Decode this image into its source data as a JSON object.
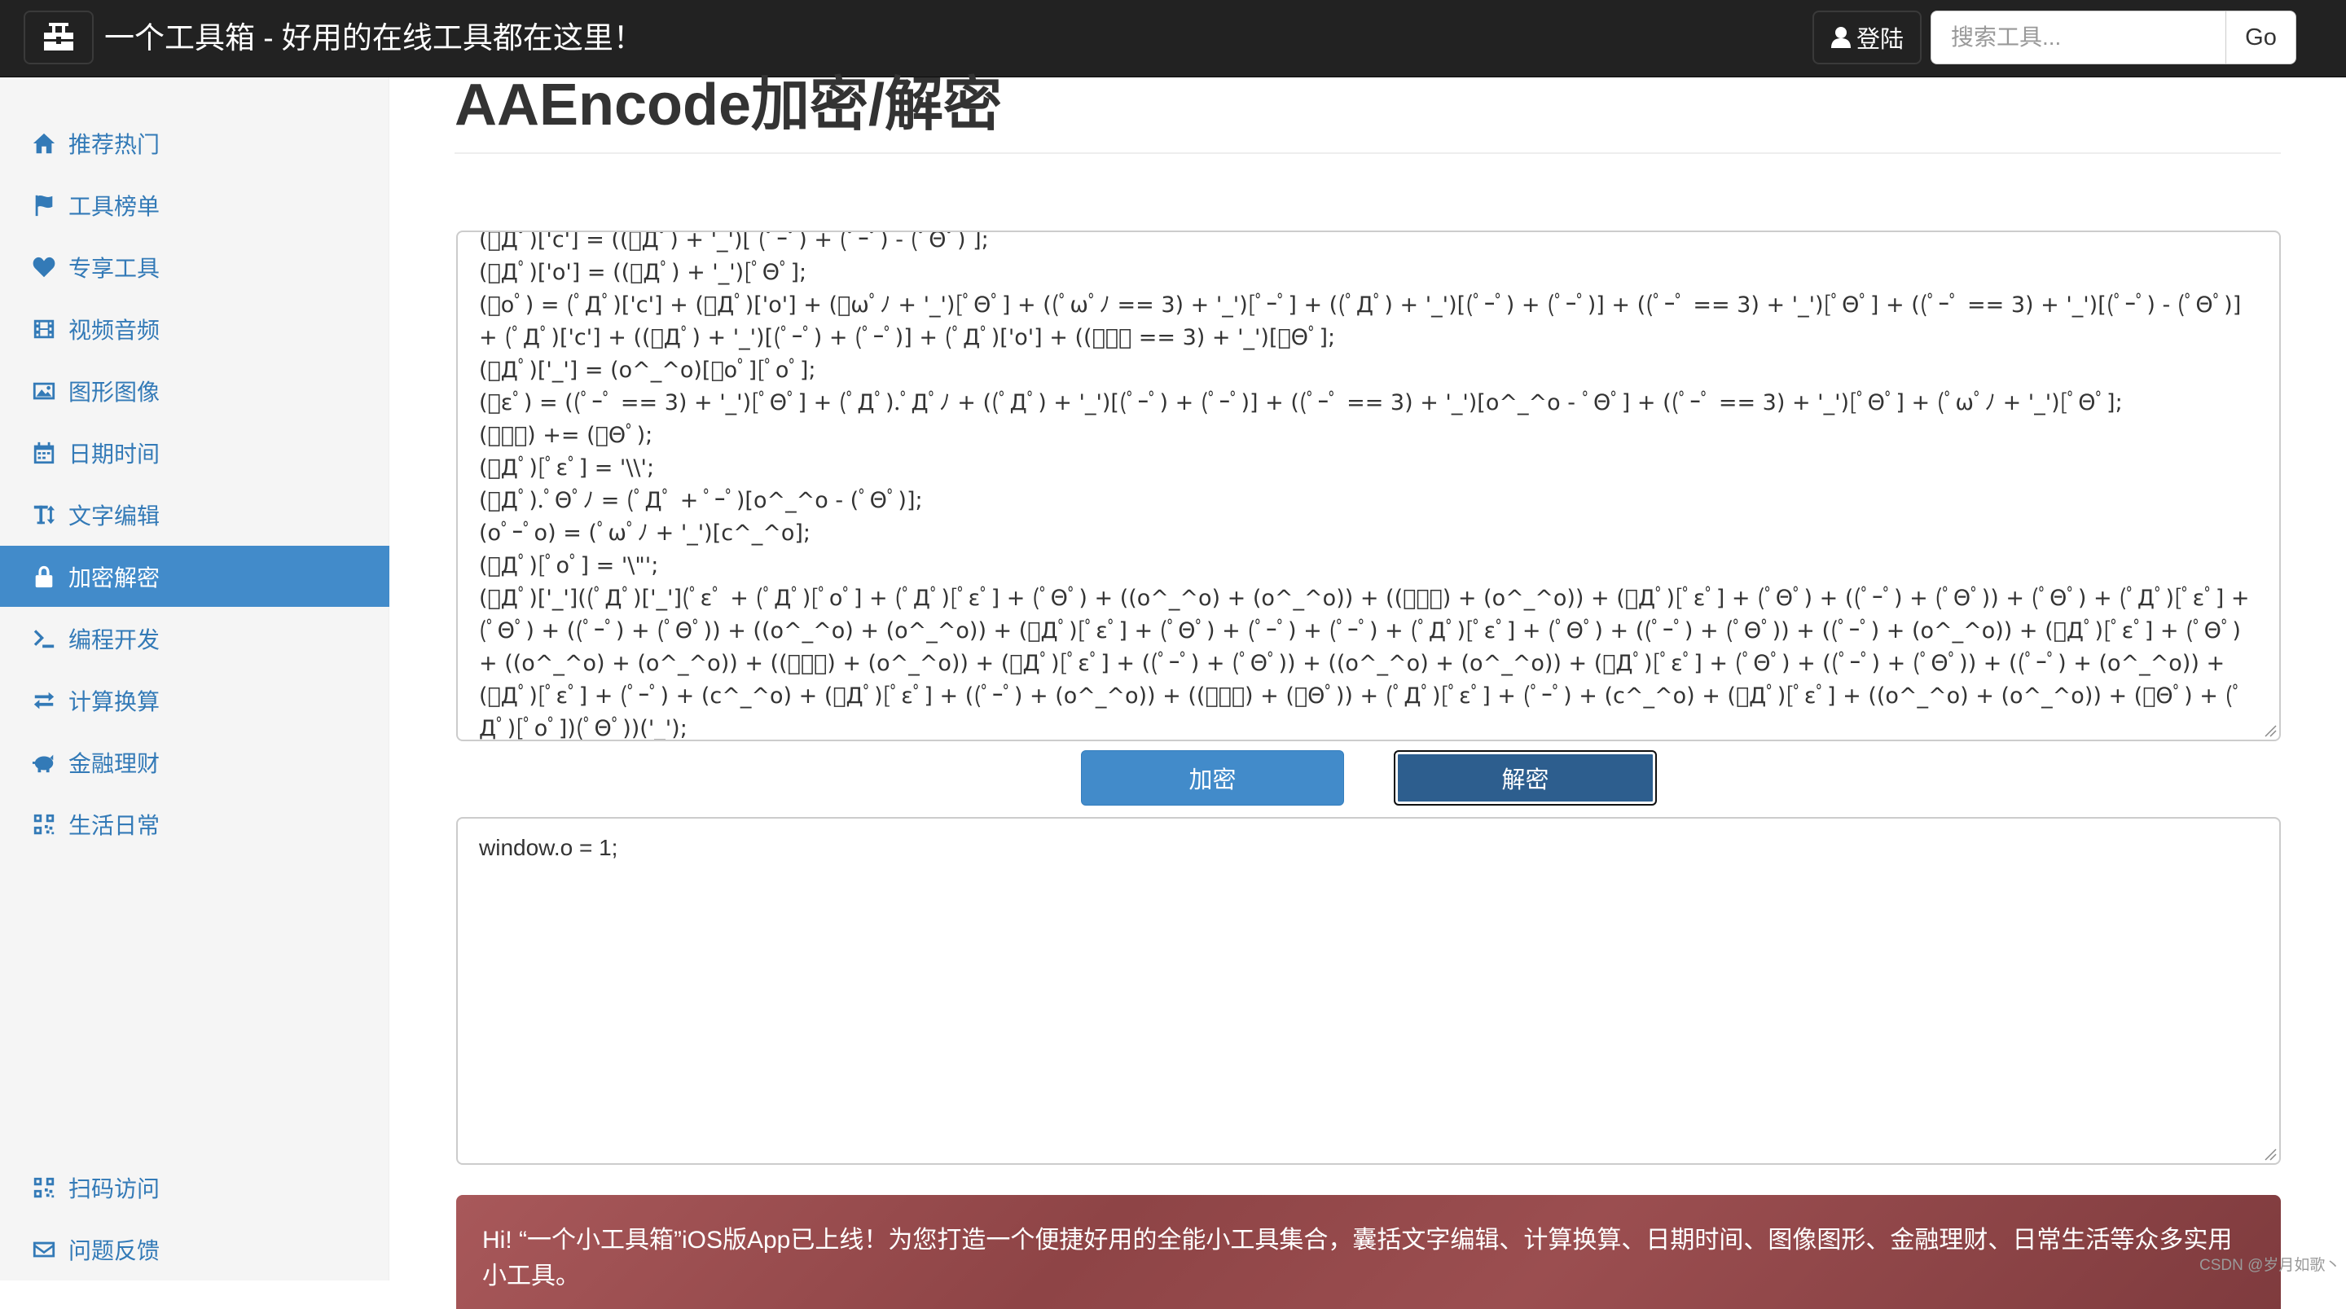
{
  "navbar": {
    "brand_icon": "toolbox-icon",
    "title": "一个工具箱 - 好用的在线工具都在这里！",
    "login_label": "登陆",
    "search_placeholder": "搜索工具...",
    "go_label": "Go"
  },
  "sidebar": {
    "items": [
      {
        "label": "推荐热门",
        "icon": "home-icon"
      },
      {
        "label": "工具榜单",
        "icon": "flag-icon"
      },
      {
        "label": "专享工具",
        "icon": "heart-icon"
      },
      {
        "label": "视频音频",
        "icon": "film-icon"
      },
      {
        "label": "图形图像",
        "icon": "picture-icon"
      },
      {
        "label": "日期时间",
        "icon": "calendar-icon"
      },
      {
        "label": "文字编辑",
        "icon": "text-height-icon"
      },
      {
        "label": "加密解密",
        "icon": "lock-icon",
        "active": true
      },
      {
        "label": "编程开发",
        "icon": "terminal-icon"
      },
      {
        "label": "计算换算",
        "icon": "transfer-icon"
      },
      {
        "label": "金融理财",
        "icon": "piggy-bank-icon"
      },
      {
        "label": "生活日常",
        "icon": "qrcode-icon"
      }
    ],
    "bottom_items": [
      {
        "label": "扫码访问",
        "icon": "qrcode-icon"
      },
      {
        "label": "问题反馈",
        "icon": "envelope-icon"
      }
    ]
  },
  "main": {
    "title": "AAEncode加密/解密",
    "encoded_lines": [
      "(ﾟДﾟ)['c'] = ((ﾟДﾟ) + '_')[ (ﾟｰﾟ) + (ﾟｰﾟ) - (ﾟΘﾟ) ];",
      "(ﾟДﾟ)['o'] = ((ﾟДﾟ) + '_')[ﾟΘﾟ];",
      "(ﾟoﾟ) = (ﾟДﾟ)['c'] + (ﾟДﾟ)['o'] + (ﾟωﾟﾉ + '_')[ﾟΘﾟ] + ((ﾟωﾟﾉ == 3) + '_')[ﾟｰﾟ] + ((ﾟДﾟ) + '_')[(ﾟｰﾟ) + (ﾟｰﾟ)] + ((ﾟｰﾟ == 3) + '_')[ﾟΘﾟ] + ((ﾟｰﾟ == 3) + '_')[(ﾟｰﾟ) - (ﾟΘﾟ)] + (ﾟДﾟ)['c'] + ((ﾟДﾟ) + '_')[(ﾟｰﾟ) + (ﾟｰﾟ)] + (ﾟДﾟ)['o'] + ((ﾟｰﾟ == 3) + '_')[ﾟΘﾟ];",
      "(ﾟДﾟ)['_'] = (o^_^o)[ﾟoﾟ][ﾟoﾟ];",
      "(ﾟεﾟ) = ((ﾟｰﾟ == 3) + '_')[ﾟΘﾟ] + (ﾟДﾟ).ﾟДﾟﾉ + ((ﾟДﾟ) + '_')[(ﾟｰﾟ) + (ﾟｰﾟ)] + ((ﾟｰﾟ == 3) + '_')[o^_^o - ﾟΘﾟ] + ((ﾟｰﾟ == 3) + '_')[ﾟΘﾟ] + (ﾟωﾟﾉ + '_')[ﾟΘﾟ];",
      "(ﾟｰﾟ) += (ﾟΘﾟ);",
      "(ﾟДﾟ)[ﾟεﾟ] = '\\\\';",
      "(ﾟДﾟ).ﾟΘﾟﾉ = (ﾟДﾟ + ﾟｰﾟ)[o^_^o - (ﾟΘﾟ)];",
      "(oﾟｰﾟo) = (ﾟωﾟﾉ + '_')[c^_^o];",
      "(ﾟДﾟ)[ﾟoﾟ] = '\\\"';",
      "(ﾟДﾟ)['_']((ﾟДﾟ)['_'](ﾟεﾟ + (ﾟДﾟ)[ﾟoﾟ] + (ﾟДﾟ)[ﾟεﾟ] + (ﾟΘﾟ) + ((o^_^o) + (o^_^o)) + ((ﾟｰﾟ) + (o^_^o)) + (ﾟДﾟ)[ﾟεﾟ] + (ﾟΘﾟ) + ((ﾟｰﾟ) + (ﾟΘﾟ)) + (ﾟΘﾟ) + (ﾟДﾟ)[ﾟεﾟ] + (ﾟΘﾟ) + ((ﾟｰﾟ) + (ﾟΘﾟ)) + ((o^_^o) + (o^_^o)) + (ﾟДﾟ)[ﾟεﾟ] + (ﾟΘﾟ) + (ﾟｰﾟ) + (ﾟｰﾟ) + (ﾟДﾟ)[ﾟεﾟ] + (ﾟΘﾟ) + ((ﾟｰﾟ) + (ﾟΘﾟ)) + ((ﾟｰﾟ) + (o^_^o)) + (ﾟДﾟ)[ﾟεﾟ] + (ﾟΘﾟ) + ((o^_^o) + (o^_^o)) + ((ﾟｰﾟ) + (o^_^o)) + (ﾟДﾟ)[ﾟεﾟ] + ((ﾟｰﾟ) + (ﾟΘﾟ)) + ((o^_^o) + (o^_^o)) + (ﾟДﾟ)[ﾟεﾟ] + (ﾟΘﾟ) + ((ﾟｰﾟ) + (ﾟΘﾟ)) + ((ﾟｰﾟ) + (o^_^o)) + (ﾟДﾟ)[ﾟεﾟ] + (ﾟｰﾟ) + (c^_^o) + (ﾟДﾟ)[ﾟεﾟ] + ((ﾟｰﾟ) + (o^_^o)) + ((ﾟｰﾟ) + (ﾟΘﾟ)) + (ﾟДﾟ)[ﾟεﾟ] + (ﾟｰﾟ) + (c^_^o) + (ﾟДﾟ)[ﾟεﾟ] + ((o^_^o) + (o^_^o)) + (ﾟΘﾟ) + (ﾟДﾟ)[ﾟoﾟ])(ﾟΘﾟ))('_');"
    ],
    "encrypt_label": "加密",
    "decrypt_label": "解密",
    "output_text": "window.o = 1;",
    "notice_text": "Hi! “一个小工具箱”iOS版App已上线！为您打造一个便捷好用的全能小工具集合，囊括文字编辑、计算换算、日期时间、图像图形、金融理财、日常生活等众多实用小工具。",
    "watermark": "CSDN @岁月如歌丶"
  },
  "colors": {
    "navbar_bg": "#222222",
    "sidebar_bg": "#f5f5f5",
    "link": "#337ab7",
    "active_bg": "#428bca",
    "notice_bg": "#8e4446"
  }
}
